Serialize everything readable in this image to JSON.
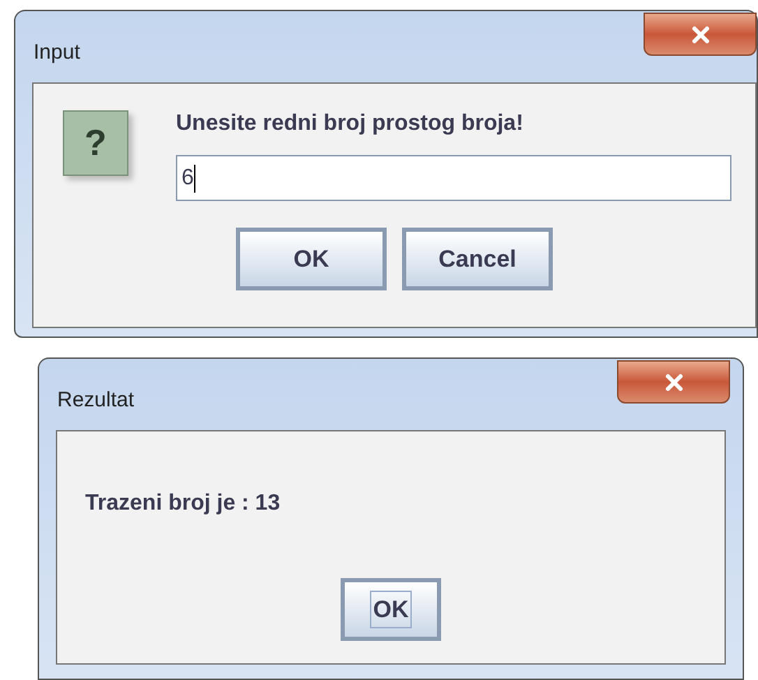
{
  "dialogs": [
    {
      "title": "Input",
      "kind": "input",
      "message": "Unesite redni broj prostog broja!",
      "icon": "?",
      "field": {
        "value": "6"
      },
      "buttons": [
        {
          "label": "OK",
          "focused": false
        },
        {
          "label": "Cancel",
          "focused": false
        }
      ]
    },
    {
      "title": "Rezultat",
      "kind": "message",
      "message": "Trazeni broj je : 13",
      "buttons": [
        {
          "label": "OK",
          "focused": true
        }
      ]
    }
  ]
}
